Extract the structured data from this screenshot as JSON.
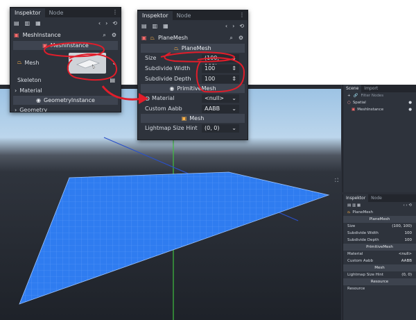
{
  "viewport": {
    "corner_icon": "⛶",
    "colors": {
      "plane": "#2f7cf0",
      "grid": "#6aa6ff",
      "axis_green": "#3fbf3f",
      "axis_blue": "#2a50c8",
      "annotation": "#e11d2a"
    }
  },
  "scene_dock": {
    "tabs": [
      "Scene",
      "Import"
    ],
    "filter_placeholder": "Filter Nodes",
    "nodes": [
      {
        "name": "Spatial",
        "icon": "spatial-icon"
      },
      {
        "name": "MeshInstance",
        "icon": "meshinstance-icon"
      }
    ]
  },
  "mini_inspector": {
    "tabs": [
      "Inspektor",
      "Node"
    ],
    "object": "PlaneMesh",
    "sections": {
      "planemesh": "PlaneMesh",
      "primitive": "PrimitiveMesh",
      "mesh": "Mesh",
      "resource": "Resource"
    },
    "rows": [
      {
        "label": "Size",
        "value": "(100, 100)"
      },
      {
        "label": "Subdivide Width",
        "value": "100"
      },
      {
        "label": "Subdivide Depth",
        "value": "100"
      },
      {
        "label": "Material",
        "value": "<null>"
      },
      {
        "label": "Custom Aabb",
        "value": "AABB"
      },
      {
        "label": "Lightmap Size Hint",
        "value": "(0, 0)"
      }
    ],
    "footer": "Resource"
  },
  "left_panel": {
    "tabs": [
      "Inspektor",
      "Node"
    ],
    "menu": "⋮",
    "object": "MeshInstance",
    "section": "MeshInstance",
    "mesh_label": "Mesh",
    "skeleton_label": "Skeleton",
    "material_label": "Material",
    "geometry_section": "GeometryInstance",
    "geometry_label": "Geometry"
  },
  "right_panel": {
    "tabs": [
      "Inspektor",
      "Node"
    ],
    "menu": "⋮",
    "object": "PlaneMesh",
    "section_planemesh": "PlaneMesh",
    "rows": [
      {
        "label": "Size",
        "value": "(100, 100)",
        "widget": "⌄"
      },
      {
        "label": "Subdivide Width",
        "value": "100",
        "widget": "⇕"
      },
      {
        "label": "Subdivide Depth",
        "value": "100",
        "widget": "⇕"
      }
    ],
    "section_primitive": "PrimitiveMesh",
    "material_label": "Material",
    "material_value": "<null>",
    "aabb_label": "Custom Aabb",
    "aabb_value": "AABB",
    "section_mesh": "Mesh",
    "lightmap_label": "Lightmap Size Hint",
    "lightmap_value": "(0, 0)"
  }
}
